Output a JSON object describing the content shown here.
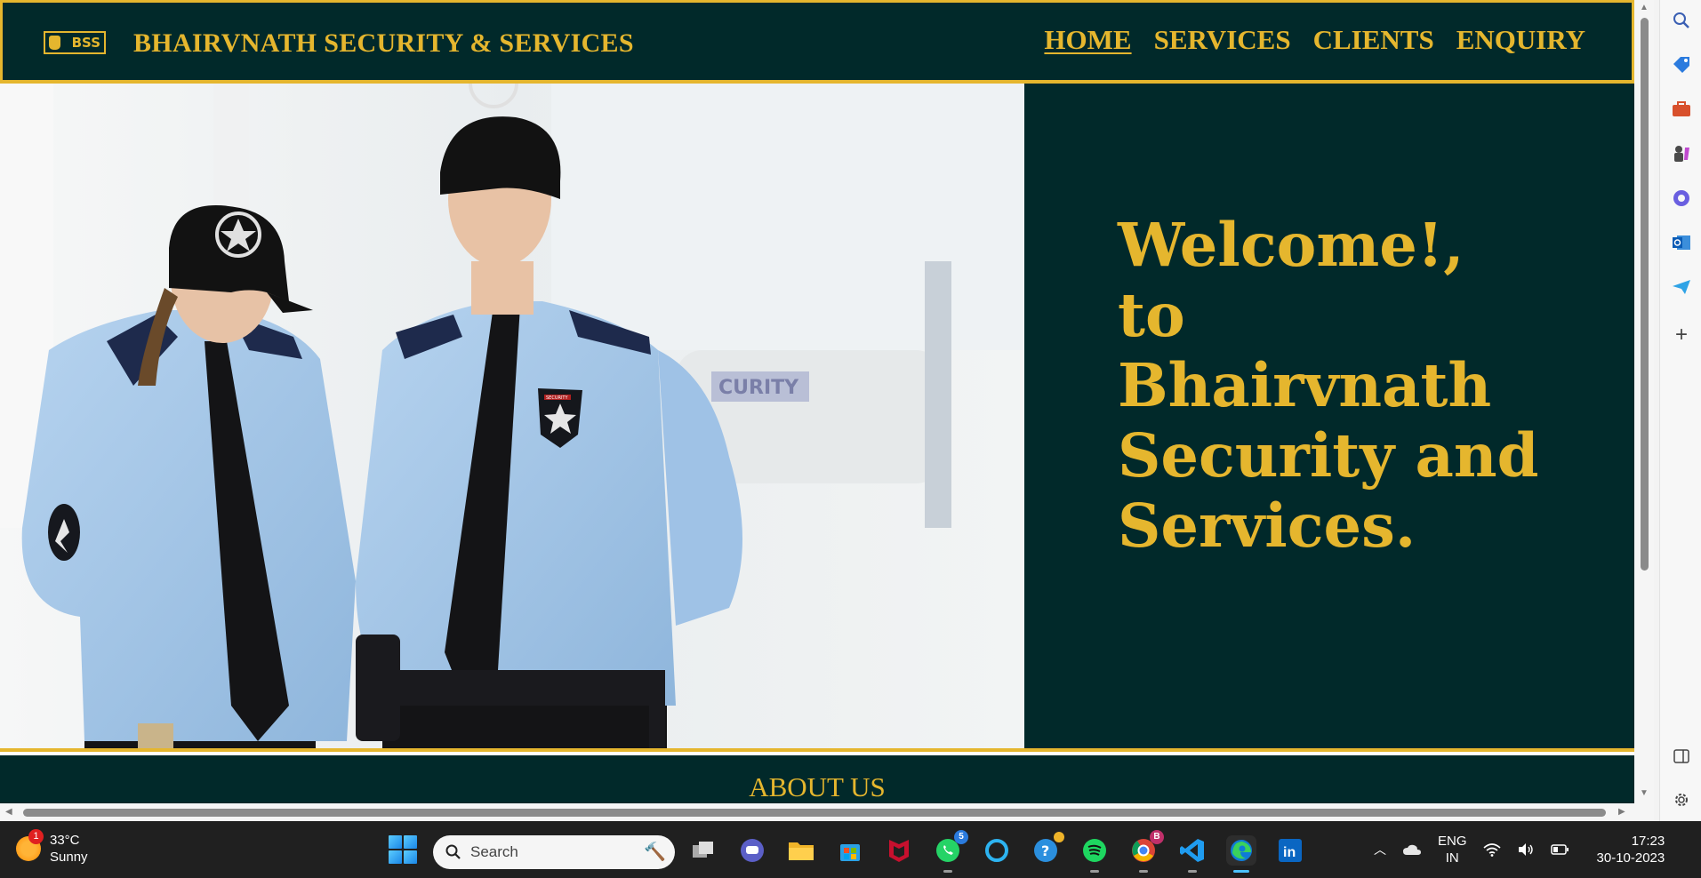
{
  "header": {
    "logo_text": "BSS",
    "title": "BHAIRVNATH SECURITY & SERVICES",
    "nav": [
      {
        "label": "HOME",
        "active": true
      },
      {
        "label": "SERVICES",
        "active": false
      },
      {
        "label": "CLIENTS",
        "active": false
      },
      {
        "label": "ENQUIRY",
        "active": false
      }
    ]
  },
  "hero": {
    "lines": [
      "Welcome!,",
      "to",
      "Bhairvnath",
      "Security and",
      "Services."
    ],
    "photo_badge_text": "SECURITY",
    "photo_wall_text": "CURITY"
  },
  "about": {
    "title": "ABOUT US"
  },
  "colors": {
    "navy": "#01292a",
    "gold": "#e5b62e"
  },
  "edge_sidebar": [
    "search-icon",
    "tag-icon",
    "briefcase-icon",
    "chess-icon",
    "copilot-icon",
    "outlook-icon",
    "send-icon",
    "add-icon",
    "sidebar-toggle-icon",
    "settings-icon"
  ],
  "taskbar": {
    "weather": {
      "temp": "33°C",
      "condition": "Sunny",
      "badge": "1"
    },
    "search_placeholder": "Search",
    "apps": [
      {
        "name": "task-view-icon"
      },
      {
        "name": "teams-chat-icon"
      },
      {
        "name": "file-explorer-icon"
      },
      {
        "name": "microsoft-store-icon"
      },
      {
        "name": "mcafee-icon"
      },
      {
        "name": "whatsapp-icon",
        "badge": "5"
      },
      {
        "name": "cortana-icon"
      },
      {
        "name": "help-icon"
      },
      {
        "name": "spotify-icon"
      },
      {
        "name": "chrome-icon",
        "badge": "B"
      },
      {
        "name": "vscode-icon"
      },
      {
        "name": "edge-icon"
      },
      {
        "name": "linkedin-icon",
        "label": "in"
      }
    ],
    "tray": {
      "lang_top": "ENG",
      "lang_bottom": "IN",
      "time": "17:23",
      "date": "30-10-2023"
    }
  }
}
